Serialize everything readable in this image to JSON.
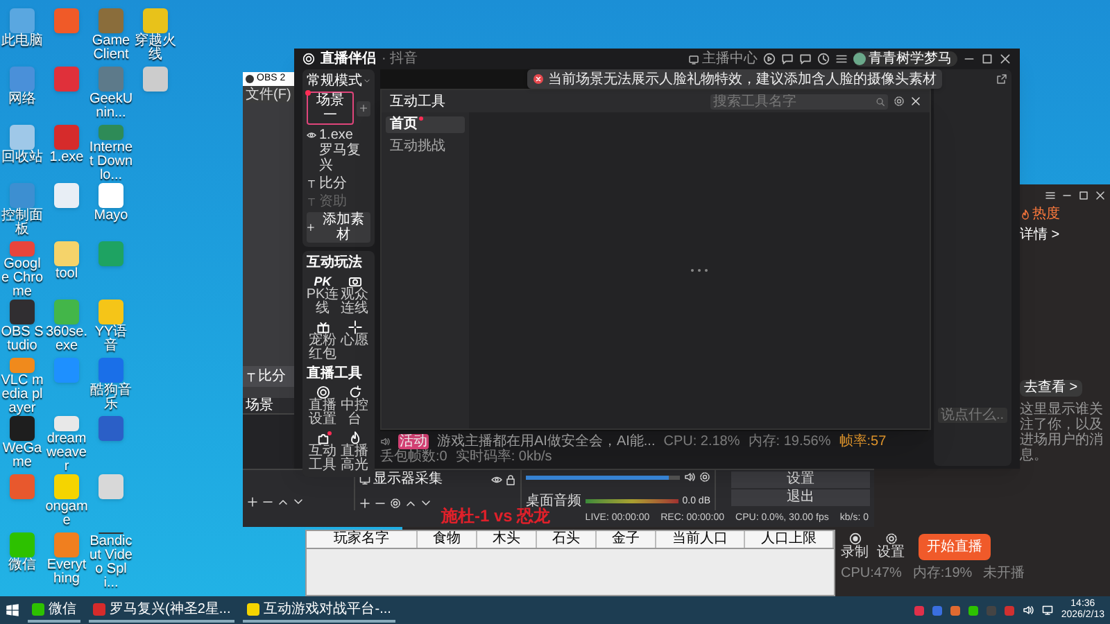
{
  "desktop_icons": [
    {
      "label": "此电脑",
      "color": "#5aa7e0"
    },
    {
      "label": "网络",
      "color": "#4a90d9"
    },
    {
      "label": "回收站",
      "color": "#9fc8e8"
    },
    {
      "label": "控制面板",
      "color": "#3d8fd1"
    },
    {
      "label": "Google Chrome",
      "color": "#e8453c"
    },
    {
      "label": "OBS Studio",
      "color": "#302e31"
    },
    {
      "label": "VLC media player",
      "color": "#f08a1c"
    },
    {
      "label": "WeGame",
      "color": "#1e1e1e"
    },
    {
      "color": "#e8582d"
    },
    {
      "label": "微信",
      "color": "#2dc100"
    },
    {
      "color": "#f05a28"
    },
    {
      "color": "#e0303a"
    },
    {
      "label": "1.exe",
      "color": "#d62b2b"
    },
    {
      "color": "#e8eef5"
    },
    {
      "label": "tool",
      "color": "#f5d36a"
    },
    {
      "label": "360se.exe",
      "color": "#43b649"
    },
    {
      "color": "#1e90ff"
    },
    {
      "label": "dreamweaver",
      "color": "#e8e8e8"
    },
    {
      "label": "ongame",
      "color": "#f5d400"
    },
    {
      "label": "Everything",
      "color": "#f07f1f"
    },
    {
      "label": "GameClient",
      "color": "#8a6d3b"
    },
    {
      "label": "GeekUnin...",
      "color": "#5d7a8a"
    },
    {
      "label": "Internet Downlo...",
      "color": "#2e8b57"
    },
    {
      "label": "Mayo",
      "color": "#ffffff"
    },
    {
      "color": "#1ea362"
    },
    {
      "label": "YY语音",
      "color": "#f5c518"
    },
    {
      "label": "酷狗音乐",
      "color": "#1a6fe8"
    },
    {
      "color": "#2b5fc7"
    },
    {
      "color": "#d8d8d8"
    },
    {
      "label": "Bandicut Video Spli...",
      "color": "#333333"
    },
    {
      "label": "穿越火线",
      "color": "#e8c21a"
    },
    {
      "color": "#cccccc"
    }
  ],
  "obs": {
    "title": "OBS 2",
    "menu": [
      "文件(F)"
    ],
    "source_item": "比分",
    "scenes_title": "场景",
    "source_dock": "显示器采集",
    "mixer": {
      "label": "桌面音频",
      "reading": "0.0 dB",
      "level": 0.93
    },
    "buttons": [
      "设置",
      "退出"
    ],
    "status": [
      "LIVE: 00:00:00",
      "REC: 00:00:00",
      "CPU: 0.0%, 30.00 fps",
      "kb/s: 0"
    ]
  },
  "companion": {
    "title": "直播伴侣",
    "platform": "· 抖音",
    "anchor_center": "主播中心",
    "user": "青青树学梦马",
    "mode": "常规模式",
    "scenes": [
      {
        "label": "场景一",
        "selected": true,
        "badge": true
      }
    ],
    "sources": [
      {
        "label": "1.exe 罗马复兴",
        "kind": "window",
        "disabled": false
      },
      {
        "label": "比分",
        "kind": "text",
        "disabled": false
      },
      {
        "label": "资助",
        "kind": "text",
        "disabled": true
      }
    ],
    "add_source": "添加素材",
    "sections": [
      {
        "title": "互动玩法",
        "tools": [
          {
            "label": "PK连线",
            "glyph": "PK",
            "badge": false
          },
          {
            "label": "观众连线",
            "badge": false
          },
          {
            "label": "宠粉红包",
            "badge": false
          },
          {
            "label": "心愿",
            "badge": false
          }
        ]
      },
      {
        "title": "直播工具",
        "tools": [
          {
            "label": "直播设置",
            "badge": false
          },
          {
            "label": "中控台",
            "badge": false
          },
          {
            "label": "互动工具",
            "badge": true
          },
          {
            "label": "直播高光",
            "badge": false
          }
        ]
      }
    ],
    "notice": {
      "tag": "活动",
      "text": "游戏主播都在用AI做安全会，AI能..."
    },
    "stats": [
      {
        "text": "CPU: 2.18%",
        "highlight": false
      },
      {
        "text": "内存: 19.56%",
        "highlight": false
      },
      {
        "text": "帧率:57",
        "highlight": true
      },
      {
        "text": "丢包帧数:0",
        "highlight": false
      },
      {
        "text": "实时码率: 0kb/s",
        "highlight": false
      }
    ],
    "chat_placeholder": "说点什么..."
  },
  "toast": "当前场景无法展示人脸礼物特效，建议添加含人脸的摄像头素材",
  "tools_dialog": {
    "title": "互动工具",
    "search_placeholder": "搜索工具名字",
    "menu": [
      {
        "label": "首页",
        "selected": true,
        "badge": true
      },
      {
        "label": "互动挑战",
        "selected": false,
        "badge": false
      }
    ]
  },
  "overlay_text": "施杜-1 vs 恐龙",
  "back_window": {
    "heat": "热度",
    "details": "详情 >",
    "view_link": "去查看 >",
    "follow_hint": "这里显示谁关注了你，以及进场用户的消息。",
    "actions": [
      "录制",
      "设置"
    ],
    "start_button": "开始直播",
    "status": [
      "CPU:47%",
      "内存:19%",
      "未开播"
    ]
  },
  "game_table": {
    "columns": [
      "玩家名字",
      "食物",
      "木头",
      "石头",
      "金子",
      "当前人口",
      "人口上限"
    ]
  },
  "taskbar": {
    "items": [
      {
        "label": "微信",
        "color": "#2dc100"
      },
      {
        "label": "罗马复兴(神圣2星...",
        "color": "#d62b2b"
      },
      {
        "label": "互动游戏对战平台-...",
        "color": "#f5d400"
      }
    ],
    "time": "14:36",
    "date": "2026/2/13"
  }
}
